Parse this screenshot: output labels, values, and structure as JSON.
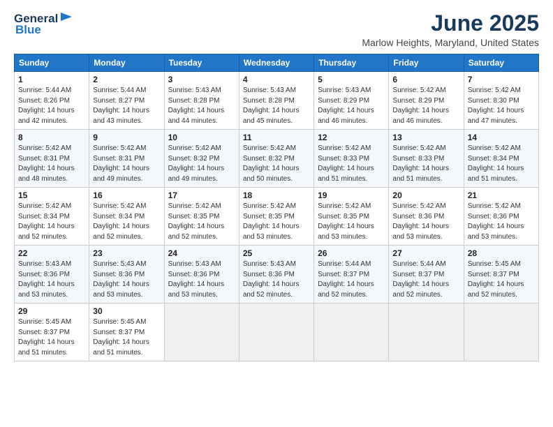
{
  "logo": {
    "general": "General",
    "blue": "Blue"
  },
  "title": "June 2025",
  "location": "Marlow Heights, Maryland, United States",
  "headers": [
    "Sunday",
    "Monday",
    "Tuesday",
    "Wednesday",
    "Thursday",
    "Friday",
    "Saturday"
  ],
  "weeks": [
    [
      {
        "day": "1",
        "sunrise": "5:44 AM",
        "sunset": "8:26 PM",
        "daylight": "14 hours and 42 minutes."
      },
      {
        "day": "2",
        "sunrise": "5:44 AM",
        "sunset": "8:27 PM",
        "daylight": "14 hours and 43 minutes."
      },
      {
        "day": "3",
        "sunrise": "5:43 AM",
        "sunset": "8:28 PM",
        "daylight": "14 hours and 44 minutes."
      },
      {
        "day": "4",
        "sunrise": "5:43 AM",
        "sunset": "8:28 PM",
        "daylight": "14 hours and 45 minutes."
      },
      {
        "day": "5",
        "sunrise": "5:43 AM",
        "sunset": "8:29 PM",
        "daylight": "14 hours and 46 minutes."
      },
      {
        "day": "6",
        "sunrise": "5:42 AM",
        "sunset": "8:29 PM",
        "daylight": "14 hours and 46 minutes."
      },
      {
        "day": "7",
        "sunrise": "5:42 AM",
        "sunset": "8:30 PM",
        "daylight": "14 hours and 47 minutes."
      }
    ],
    [
      {
        "day": "8",
        "sunrise": "5:42 AM",
        "sunset": "8:31 PM",
        "daylight": "14 hours and 48 minutes."
      },
      {
        "day": "9",
        "sunrise": "5:42 AM",
        "sunset": "8:31 PM",
        "daylight": "14 hours and 49 minutes."
      },
      {
        "day": "10",
        "sunrise": "5:42 AM",
        "sunset": "8:32 PM",
        "daylight": "14 hours and 49 minutes."
      },
      {
        "day": "11",
        "sunrise": "5:42 AM",
        "sunset": "8:32 PM",
        "daylight": "14 hours and 50 minutes."
      },
      {
        "day": "12",
        "sunrise": "5:42 AM",
        "sunset": "8:33 PM",
        "daylight": "14 hours and 51 minutes."
      },
      {
        "day": "13",
        "sunrise": "5:42 AM",
        "sunset": "8:33 PM",
        "daylight": "14 hours and 51 minutes."
      },
      {
        "day": "14",
        "sunrise": "5:42 AM",
        "sunset": "8:34 PM",
        "daylight": "14 hours and 51 minutes."
      }
    ],
    [
      {
        "day": "15",
        "sunrise": "5:42 AM",
        "sunset": "8:34 PM",
        "daylight": "14 hours and 52 minutes."
      },
      {
        "day": "16",
        "sunrise": "5:42 AM",
        "sunset": "8:34 PM",
        "daylight": "14 hours and 52 minutes."
      },
      {
        "day": "17",
        "sunrise": "5:42 AM",
        "sunset": "8:35 PM",
        "daylight": "14 hours and 52 minutes."
      },
      {
        "day": "18",
        "sunrise": "5:42 AM",
        "sunset": "8:35 PM",
        "daylight": "14 hours and 53 minutes."
      },
      {
        "day": "19",
        "sunrise": "5:42 AM",
        "sunset": "8:35 PM",
        "daylight": "14 hours and 53 minutes."
      },
      {
        "day": "20",
        "sunrise": "5:42 AM",
        "sunset": "8:36 PM",
        "daylight": "14 hours and 53 minutes."
      },
      {
        "day": "21",
        "sunrise": "5:42 AM",
        "sunset": "8:36 PM",
        "daylight": "14 hours and 53 minutes."
      }
    ],
    [
      {
        "day": "22",
        "sunrise": "5:43 AM",
        "sunset": "8:36 PM",
        "daylight": "14 hours and 53 minutes."
      },
      {
        "day": "23",
        "sunrise": "5:43 AM",
        "sunset": "8:36 PM",
        "daylight": "14 hours and 53 minutes."
      },
      {
        "day": "24",
        "sunrise": "5:43 AM",
        "sunset": "8:36 PM",
        "daylight": "14 hours and 53 minutes."
      },
      {
        "day": "25",
        "sunrise": "5:43 AM",
        "sunset": "8:36 PM",
        "daylight": "14 hours and 52 minutes."
      },
      {
        "day": "26",
        "sunrise": "5:44 AM",
        "sunset": "8:37 PM",
        "daylight": "14 hours and 52 minutes."
      },
      {
        "day": "27",
        "sunrise": "5:44 AM",
        "sunset": "8:37 PM",
        "daylight": "14 hours and 52 minutes."
      },
      {
        "day": "28",
        "sunrise": "5:45 AM",
        "sunset": "8:37 PM",
        "daylight": "14 hours and 52 minutes."
      }
    ],
    [
      {
        "day": "29",
        "sunrise": "5:45 AM",
        "sunset": "8:37 PM",
        "daylight": "14 hours and 51 minutes."
      },
      {
        "day": "30",
        "sunrise": "5:45 AM",
        "sunset": "8:37 PM",
        "daylight": "14 hours and 51 minutes."
      },
      null,
      null,
      null,
      null,
      null
    ]
  ]
}
